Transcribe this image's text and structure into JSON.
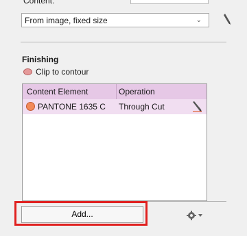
{
  "content": {
    "label": "Content:",
    "select_value": "From image, fixed size"
  },
  "finishing": {
    "title": "Finishing",
    "clip_label": "Clip to contour",
    "table": {
      "headers": [
        "Content Element",
        "Operation"
      ],
      "rows": [
        {
          "element": "PANTONE 1635 C",
          "operation": "Through Cut",
          "color": "#f28a5a"
        }
      ]
    },
    "add_label": "Add...",
    "highlight_color": "#e0201f"
  }
}
